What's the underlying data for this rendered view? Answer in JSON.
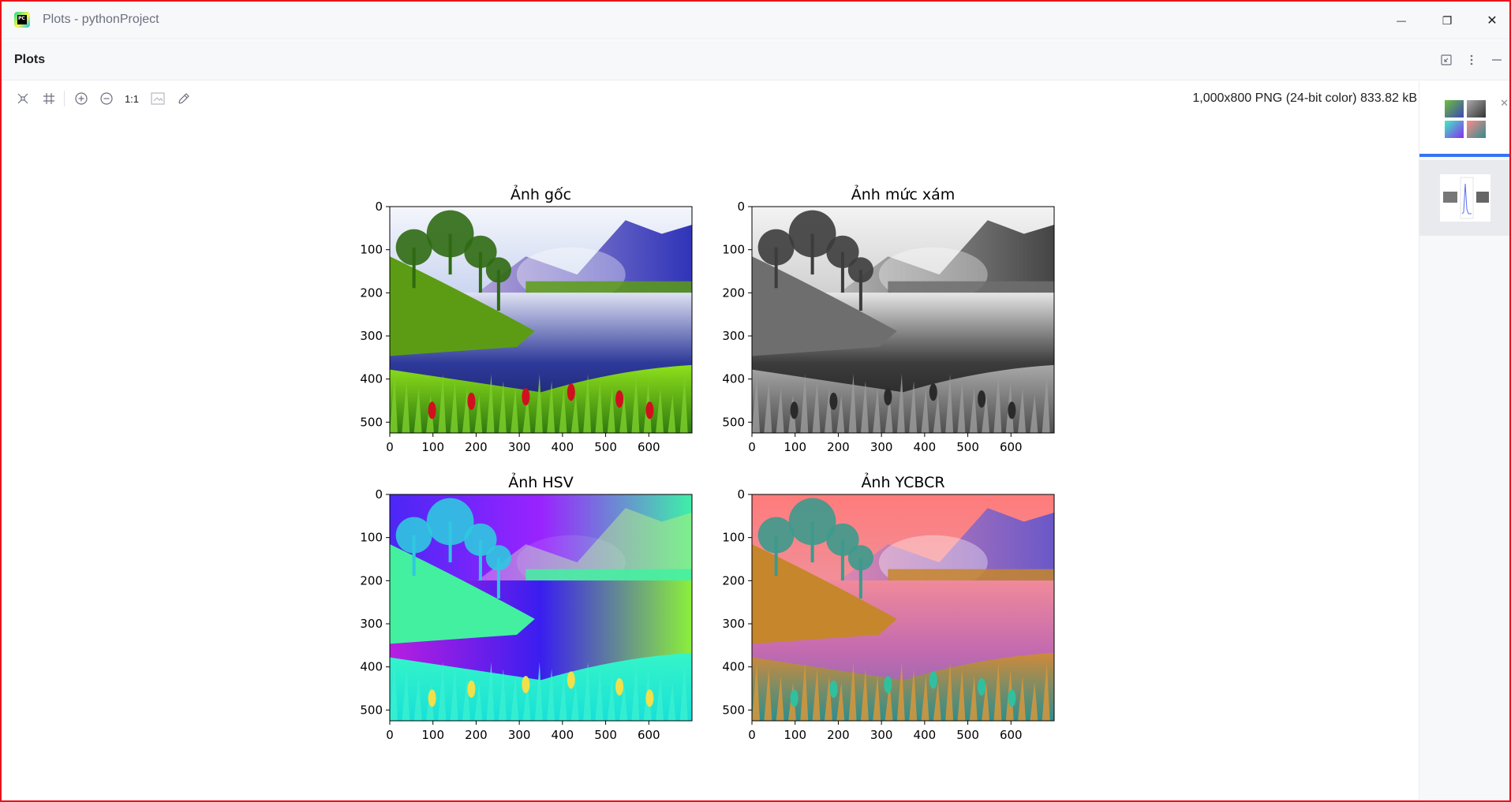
{
  "window": {
    "title": "Plots - pythonProject",
    "app_icon_text": "PC"
  },
  "controls": {
    "minimize": "—",
    "restore": "❐",
    "close": "✕"
  },
  "tool_window": {
    "title": "Plots",
    "hdr_icons": [
      "collapse-icon",
      "more-options-icon",
      "hide-icon"
    ]
  },
  "toolbar": {
    "buttons": [
      "fit-content-icon",
      "actual-grid-icon",
      "zoom-in-icon",
      "zoom-out-icon",
      "actual-size-icon",
      "background-icon",
      "color-picker-icon"
    ],
    "actual_size_label": "1:1",
    "image_info": "1,000x800 PNG (24-bit color) 833.82 kB"
  },
  "figure": {
    "subplots": [
      {
        "title": "Ảnh gốc",
        "style": "color"
      },
      {
        "title": "Ảnh mức xám",
        "style": "gray"
      },
      {
        "title": "Ảnh HSV",
        "style": "hsv"
      },
      {
        "title": "Ảnh YCBCR",
        "style": "ycbcr"
      }
    ],
    "x_ticks": [
      "0",
      "100",
      "200",
      "300",
      "400",
      "500",
      "600"
    ],
    "y_ticks": [
      "0",
      "100",
      "200",
      "300",
      "400",
      "500"
    ]
  },
  "thumbnails": {
    "close": "✕"
  },
  "colors": {
    "accent": "#3574f0",
    "frame_border": "#e8131b"
  }
}
